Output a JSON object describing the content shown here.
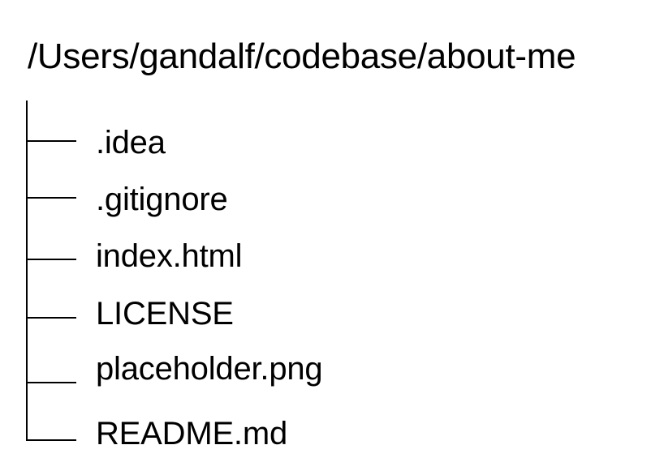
{
  "root_path": "/Users/gandalf/codebase/about-me",
  "entries": [
    {
      "name": ".idea"
    },
    {
      "name": ".gitignore"
    },
    {
      "name": "index.html"
    },
    {
      "name": "LICENSE"
    },
    {
      "name": "placeholder.png"
    },
    {
      "name": "README.md"
    }
  ],
  "colors": {
    "text": "#000000",
    "lines": "#000000",
    "background": "#ffffff"
  }
}
